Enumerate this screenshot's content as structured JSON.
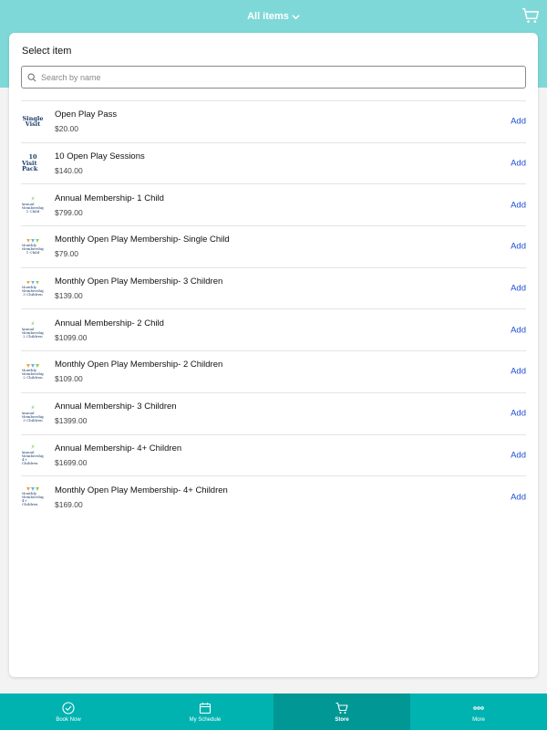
{
  "header": {
    "title": "All items"
  },
  "card": {
    "title": "Select item",
    "search_placeholder": "Search by name"
  },
  "items": [
    {
      "name": "Open Play Pass",
      "price": "$20.00",
      "add": "Add",
      "thumb": {
        "line1": "Single",
        "line2": "Visit"
      }
    },
    {
      "name": "10 Open Play Sessions",
      "price": "$140.00",
      "add": "Add",
      "thumb": {
        "line1": "10",
        "line2": "Visit Pack"
      }
    },
    {
      "name": "Annual Membership- 1 Child",
      "price": "$799.00",
      "add": "Add",
      "thumb": {
        "line1": "Annual Membership",
        "line2": "1 Child"
      }
    },
    {
      "name": "Monthly Open Play Membership- Single Child",
      "price": "$79.00",
      "add": "Add",
      "thumb": {
        "line1": "Monthly Membership",
        "line2": "1 Child"
      }
    },
    {
      "name": "Monthly Open Play Membership- 3 Children",
      "price": "$139.00",
      "add": "Add",
      "thumb": {
        "line1": "Monthly Membership",
        "line2": "3 Children"
      }
    },
    {
      "name": "Annual Membership- 2 Child",
      "price": "$1099.00",
      "add": "Add",
      "thumb": {
        "line1": "Annual Membership",
        "line2": "2 Children"
      }
    },
    {
      "name": "Monthly Open Play Membership- 2 Children",
      "price": "$109.00",
      "add": "Add",
      "thumb": {
        "line1": "Monthly Membership",
        "line2": "2 Children"
      }
    },
    {
      "name": "Annual Membership- 3 Children",
      "price": "$1399.00",
      "add": "Add",
      "thumb": {
        "line1": "Annual Membership",
        "line2": "3 Children"
      }
    },
    {
      "name": "Annual Membership- 4+ Children",
      "price": "$1699.00",
      "add": "Add",
      "thumb": {
        "line1": "Annual Membership",
        "line2": "4+ Children"
      }
    },
    {
      "name": "Monthly Open Play Membership- 4+ Children",
      "price": "$169.00",
      "add": "Add",
      "thumb": {
        "line1": "Monthly Membership",
        "line2": "4+ Children"
      }
    }
  ],
  "nav": [
    {
      "label": "Book Now",
      "icon": "check-circle-icon"
    },
    {
      "label": "My Schedule",
      "icon": "calendar-icon"
    },
    {
      "label": "Store",
      "icon": "cart-icon",
      "active": true
    },
    {
      "label": "More",
      "icon": "more-dots-icon"
    }
  ],
  "colors": {
    "header": "#7fd8d8",
    "nav": "#00b3b0",
    "nav_active": "#009794",
    "link": "#1d4fd6"
  }
}
